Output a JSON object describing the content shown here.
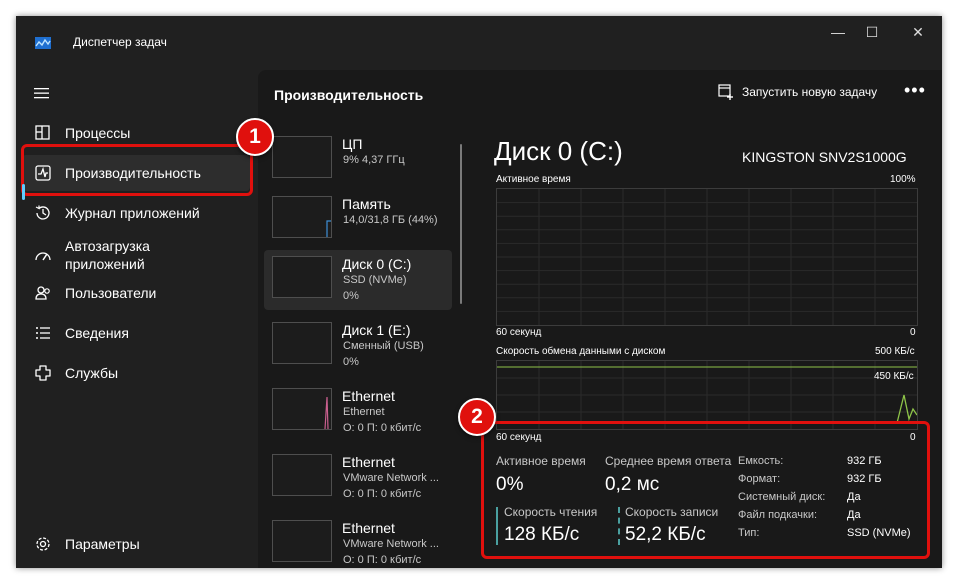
{
  "window": {
    "title": "Диспетчер задач",
    "controls": {
      "minimize": "—",
      "maximize": "☐",
      "close": "✕"
    }
  },
  "sidebar": {
    "items": [
      {
        "label": "Процессы",
        "icon": "processes-icon"
      },
      {
        "label": "Производительность",
        "icon": "performance-icon",
        "active": true
      },
      {
        "label": "Журнал приложений",
        "icon": "app-history-icon"
      },
      {
        "label": "Автозагрузка\nприложений",
        "icon": "startup-apps-icon"
      },
      {
        "label": "Пользователи",
        "icon": "users-icon"
      },
      {
        "label": "Сведения",
        "icon": "details-icon"
      },
      {
        "label": "Службы",
        "icon": "services-icon"
      }
    ],
    "settings_label": "Параметры"
  },
  "header": {
    "title": "Производительность",
    "run_task": "Запустить новую задачу",
    "more": "•••"
  },
  "perf_list": [
    {
      "name": "ЦП",
      "sub1": "9% 4,37 ГГц",
      "sub2": ""
    },
    {
      "name": "Память",
      "sub1": "14,0/31,8 ГБ (44%)",
      "sub2": ""
    },
    {
      "name": "Диск 0 (C:)",
      "sub1": "SSD (NVMe)",
      "sub2": "0%"
    },
    {
      "name": "Диск 1 (E:)",
      "sub1": "Сменный (USB)",
      "sub2": "0%"
    },
    {
      "name": "Ethernet",
      "sub1": "Ethernet",
      "sub2": "О: 0 П: 0 кбит/с"
    },
    {
      "name": "Ethernet",
      "sub1": "VMware Network ...",
      "sub2": "О: 0 П: 0 кбит/с"
    },
    {
      "name": "Ethernet",
      "sub1": "VMware Network ...",
      "sub2": "О: 0 П: 0 кбит/с"
    }
  ],
  "detail": {
    "title": "Диск 0 (C:)",
    "model": "KINGSTON SNV2S1000G",
    "graph1": {
      "label": "Активное время",
      "max": "100%",
      "time": "60 секунд",
      "min": "0"
    },
    "graph2": {
      "label": "Скорость обмена данными с диском",
      "max": "500 КБ/с",
      "mid": "450 КБ/с",
      "time": "60 секунд",
      "min": "0"
    },
    "stats": {
      "active_time": {
        "label": "Активное время",
        "value": "0%"
      },
      "response_time": {
        "label": "Среднее время ответа",
        "value": "0,2 мс"
      },
      "read_speed": {
        "label": "Скорость чтения",
        "value": "128 КБ/с"
      },
      "write_speed": {
        "label": "Скорость записи",
        "value": "52,2 КБ/с"
      }
    },
    "props": [
      {
        "key": "Емкость:",
        "value": "932 ГБ"
      },
      {
        "key": "Формат:",
        "value": "932 ГБ"
      },
      {
        "key": "Системный диск:",
        "value": "Да"
      },
      {
        "key": "Файл подкачки:",
        "value": "Да"
      },
      {
        "key": "Тип:",
        "value": "SSD (NVMe)"
      }
    ]
  },
  "annotations": {
    "badge1": "1",
    "badge2": "2"
  },
  "colors": {
    "accent": "#60cdff",
    "highlight": "#e0100d",
    "disk_graph": "#8ec449",
    "network_spark": "#c95f8e"
  }
}
